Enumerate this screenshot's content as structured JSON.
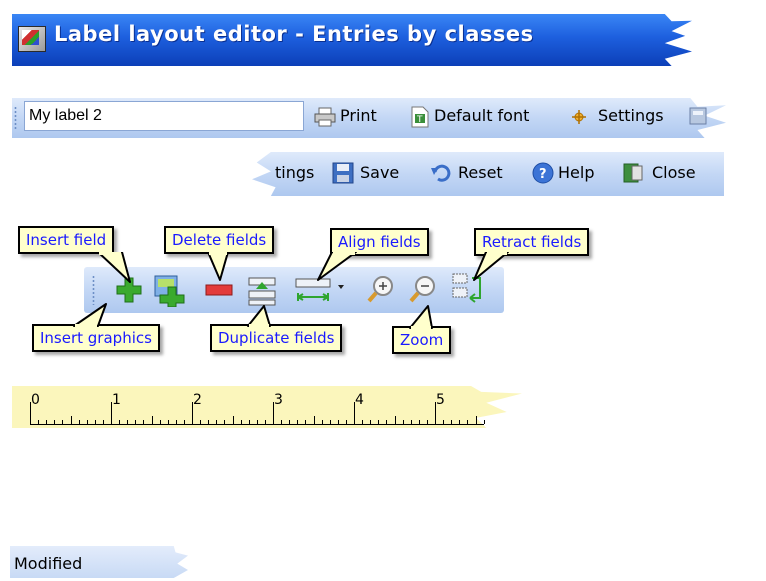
{
  "window": {
    "title": "Label layout editor - Entries by classes"
  },
  "toolbar_main": {
    "label_name_value": "My label 2",
    "print_label": "Print",
    "default_font_label": "Default font",
    "settings_label": "Settings"
  },
  "toolbar_overflow": {
    "settings_partial_label": "tings",
    "save_label": "Save",
    "reset_label": "Reset",
    "help_label": "Help",
    "close_label": "Close"
  },
  "format_toolbar": {
    "buttons": [
      {
        "icon": "insert-field-icon"
      },
      {
        "icon": "insert-graphics-icon"
      },
      {
        "icon": "delete-fields-icon"
      },
      {
        "icon": "duplicate-fields-icon"
      },
      {
        "icon": "align-fields-icon"
      },
      {
        "icon": "zoom-in-icon"
      },
      {
        "icon": "zoom-out-icon"
      },
      {
        "icon": "retract-fields-icon"
      }
    ]
  },
  "callouts": {
    "insert_field": "Insert field",
    "delete_fields": "Delete fields",
    "align_fields": "Align fields",
    "retract_fields": "Retract fields",
    "insert_graphics": "Insert graphics",
    "duplicate_fields": "Duplicate fields",
    "zoom": "Zoom"
  },
  "ruler": {
    "numbers": [
      "0",
      "1",
      "2",
      "3",
      "4",
      "5"
    ]
  },
  "status_bar": {
    "text": "Modified"
  },
  "colors": {
    "title_bar": "#1d5fde",
    "toolbar": "#c3d7f5",
    "callout_bg": "#ffffcc",
    "callout_text": "#1a1aff",
    "ruler_bg": "#fbf6bc"
  }
}
